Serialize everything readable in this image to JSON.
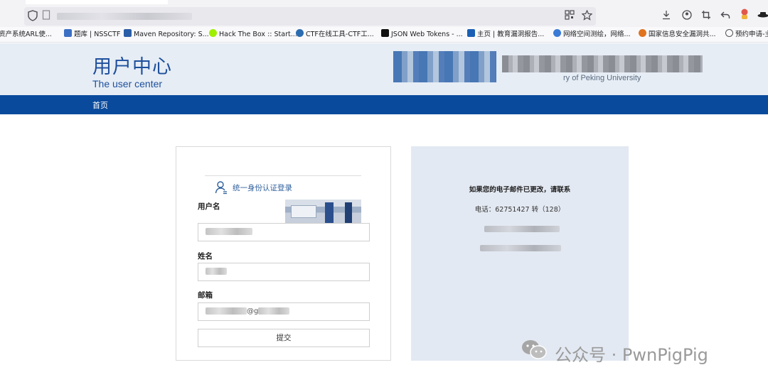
{
  "browser": {
    "bookmarks": [
      {
        "label": "资产系统ARL使...",
        "color": "#5a8fd6"
      },
      {
        "label": "题库 | NSSCTF",
        "color": "#3c6fc4"
      },
      {
        "label": "Maven Repository: S...",
        "color": "#2c5ea8"
      },
      {
        "label": "Hack The Box :: Start...",
        "color": "#9fef00"
      },
      {
        "label": "CTF在线工具-CTF工...",
        "color": "#2b6cb0"
      },
      {
        "label": "JSON Web Tokens - ...",
        "color": "#111111"
      },
      {
        "label": "主页 | 教育漏洞报告...",
        "color": "#1a5fb4"
      },
      {
        "label": "网络空间测绘，网络...",
        "color": "#3b7bd6"
      },
      {
        "label": "国家信息安全漏洞共...",
        "color": "#e0731f"
      },
      {
        "label": "预约申请-主",
        "color": "#555555"
      }
    ]
  },
  "site": {
    "title": "用户中心",
    "subtitle": "The user center",
    "logo_partial_text": "ry of Peking University",
    "nav_home": "首页"
  },
  "login": {
    "sso_link": "统一身份认证登录",
    "username_label": "用户名",
    "name_label": "姓名",
    "email_label": "邮箱",
    "email_partial": "@g",
    "submit": "提交"
  },
  "info": {
    "heading": "如果您的电子邮件已更改，请联系",
    "phone": "电话：62751427 转（128）"
  },
  "watermark": {
    "text": "公众号 · PwnPigPig"
  },
  "colors": {
    "brand_blue": "#1e4f9c",
    "nav_blue": "#0a4a9c",
    "header_bg": "#e6edf5",
    "info_bg": "#e3e9f2"
  }
}
